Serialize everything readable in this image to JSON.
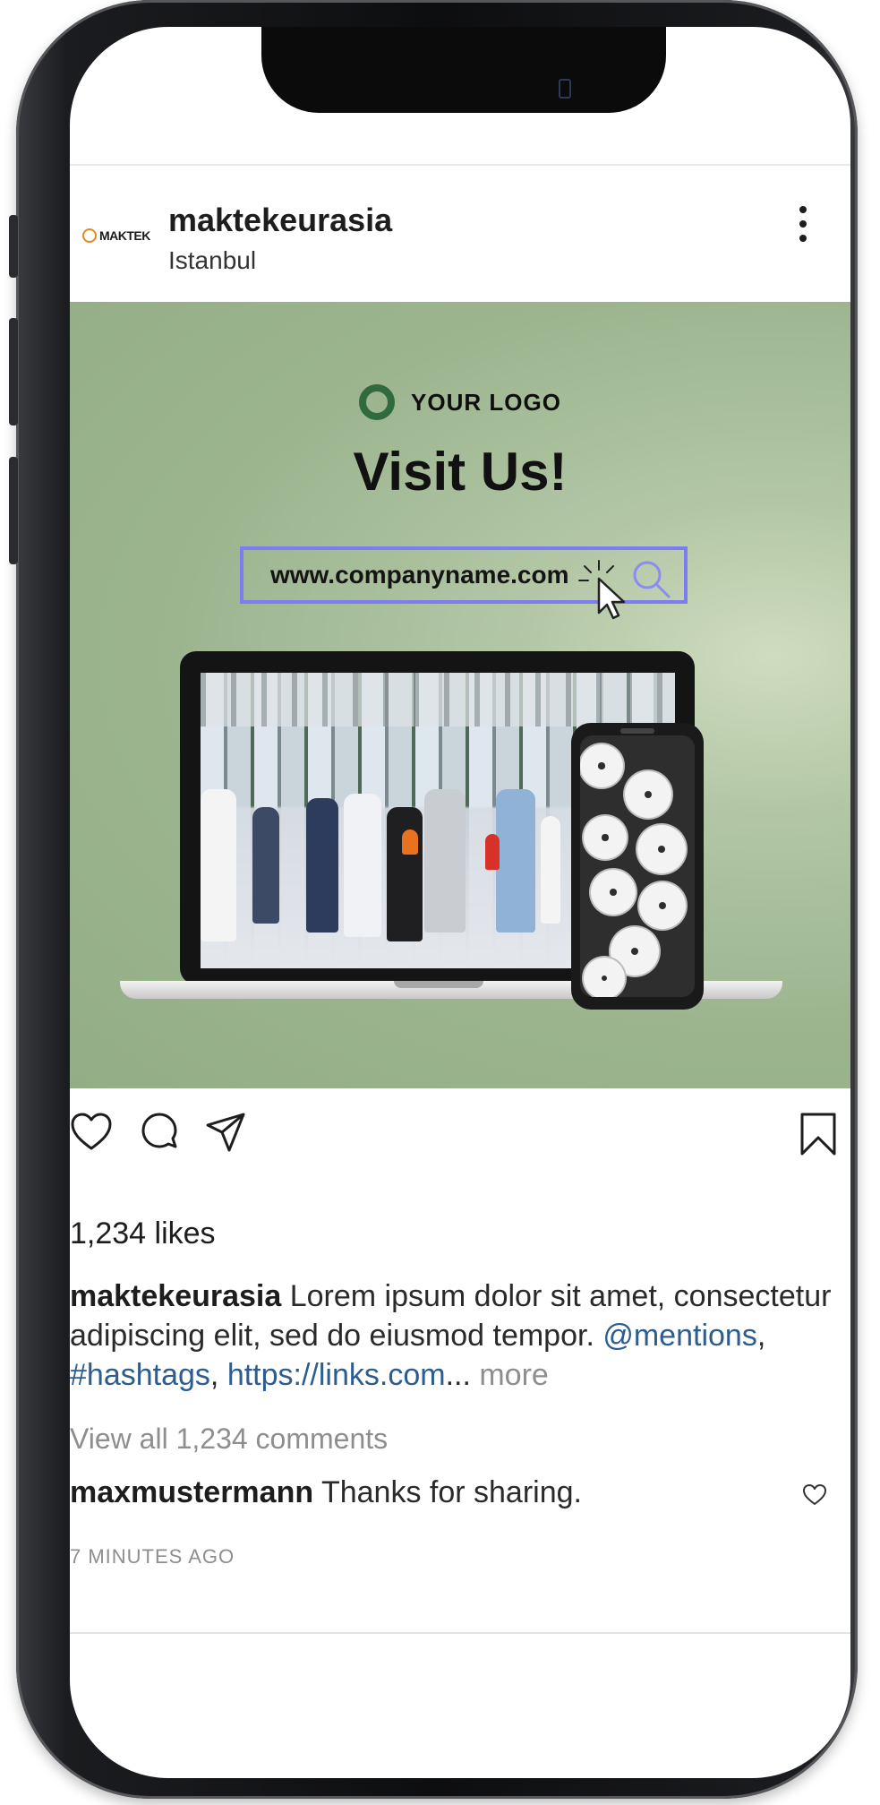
{
  "post": {
    "avatar_text": "MAKTEK",
    "username": "maktekeurasia",
    "location": "Istanbul"
  },
  "image": {
    "logo_text": "YOUR LOGO",
    "headline": "Visit Us!",
    "url_text": "www.companyname.com"
  },
  "engagement": {
    "likes": "1,234 likes",
    "caption_user": "maktekeurasia",
    "caption_text": " Lorem ipsum dolor sit amet, consectetur adipiscing elit, sed do eiusmod tempor. ",
    "caption_mentions": "@mentions",
    "caption_sep": ", ",
    "caption_hashtags": "#hashtags",
    "caption_link": "https://links.com",
    "caption_ellipsis": "...",
    "caption_more": " more",
    "view_all": "View all 1,234 comments",
    "comment_user": "maxmustermann",
    "comment_text": " Thanks for sharing.",
    "time_ago": "7 MINUTES AGO"
  },
  "icons": {
    "more": "more-vertical-icon",
    "like": "heart-icon",
    "comment": "comment-icon",
    "share": "send-icon",
    "save": "bookmark-icon",
    "search": "search-icon",
    "cursor": "pointer-cursor-icon"
  },
  "colors": {
    "image_background": "#9cb58f",
    "url_box_border": "#7b7df0",
    "logo_mark": "#2f6b3d",
    "link_color": "#2c5d8e",
    "muted_text": "#8e8e8e"
  }
}
